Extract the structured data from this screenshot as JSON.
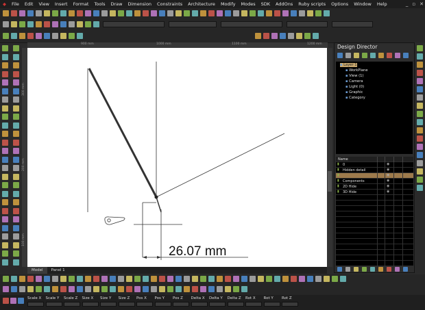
{
  "menu": [
    "File",
    "Edit",
    "View",
    "Insert",
    "Format",
    "Tools",
    "Draw",
    "Dimension",
    "Constraints",
    "Architecture",
    "Modify",
    "Modes",
    "SDK",
    "AddOns",
    "Ruby scripts",
    "Options",
    "Window",
    "Help"
  ],
  "window_controls": {
    "minimize": "_",
    "restore": "▫",
    "close": "✕"
  },
  "ruler": {
    "top": [
      "900 mm",
      "1000 mm",
      "1100 mm",
      "1200 mm"
    ],
    "left": [
      "300 mm",
      "200 mm",
      "100 mm"
    ]
  },
  "canvas": {
    "dimension_text": "26.07 mm"
  },
  "view_tabs": [
    "Model",
    "Panel 1"
  ],
  "design_director": {
    "title": "Design Director",
    "tree": [
      {
        "label": "Layer 1",
        "indent": 0,
        "selected": true
      },
      {
        "label": "WorkPlane",
        "indent": 1
      },
      {
        "label": "View (1)",
        "indent": 1
      },
      {
        "label": "Camera",
        "indent": 1
      },
      {
        "label": "Light (0)",
        "indent": 1
      },
      {
        "label": "Graphic",
        "indent": 1
      },
      {
        "label": "Category",
        "indent": 1
      }
    ],
    "grid_header": "Name",
    "rows": [
      "0",
      "Hidden detail",
      "",
      "Components",
      "2D Hide",
      "3D Hide"
    ]
  },
  "status_labels": [
    "Scale X",
    "Scale Y",
    "Scale Z",
    "Size X",
    "Size Y",
    "Size Z",
    "Pos X",
    "Pos Y",
    "Pos Z",
    "Delta X",
    "Delta Y",
    "Delta Z",
    "Rot X",
    "Rot Y",
    "Rot Z"
  ],
  "colors": {
    "canvas": "#ffffff",
    "panel": "#2b2b2b",
    "accent": "#c8a86e",
    "selection": "#9d7a4c"
  }
}
